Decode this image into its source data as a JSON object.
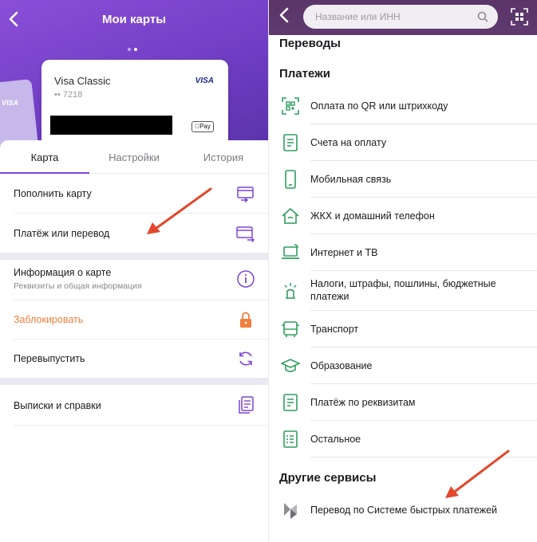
{
  "left": {
    "header": {
      "title": "Мои карты"
    },
    "card": {
      "name": "Visa Classic",
      "number": "•• 7218",
      "brand": "VISA",
      "pay_badge": "Pay",
      "back_brand": "VISA"
    },
    "tabs": [
      {
        "label": "Карта",
        "active": true
      },
      {
        "label": "Настройки",
        "active": false
      },
      {
        "label": "История",
        "active": false
      }
    ],
    "menu": {
      "top_up": "Пополнить карту",
      "pay_transfer": "Платёж или перевод",
      "info_title": "Информация о карте",
      "info_sub": "Реквизиты и общая информация",
      "block": "Заблокировать",
      "reissue": "Перевыпустить",
      "statements": "Выписки и справки"
    }
  },
  "right": {
    "search": {
      "placeholder": "Название или ИНН"
    },
    "sections": {
      "transfers": "Переводы",
      "payments": "Платежи",
      "other": "Другие сервисы"
    },
    "payments": [
      {
        "label": "Оплата по QR или штрихкоду",
        "icon": "qr-icon"
      },
      {
        "label": "Счета на оплату",
        "icon": "invoice-icon"
      },
      {
        "label": "Мобильная связь",
        "icon": "phone-icon"
      },
      {
        "label": "ЖКХ и домашний телефон",
        "icon": "house-icon"
      },
      {
        "label": "Интернет и ТВ",
        "icon": "laptop-icon"
      },
      {
        "label": "Налоги, штрафы, пошлины, бюджетные платежи",
        "icon": "tax-icon"
      },
      {
        "label": "Транспорт",
        "icon": "bus-icon"
      },
      {
        "label": "Образование",
        "icon": "graduation-icon"
      },
      {
        "label": "Платёж по реквизитам",
        "icon": "document-icon"
      },
      {
        "label": "Остальное",
        "icon": "list-icon"
      }
    ],
    "other": [
      {
        "label": "Перевод по Системе быстрых платежей",
        "icon": "sbp-icon"
      }
    ]
  },
  "colors": {
    "accent": "#7c45d6",
    "green": "#2f9e5e",
    "orange": "#f07f3c",
    "arrow": "#e2472c"
  }
}
